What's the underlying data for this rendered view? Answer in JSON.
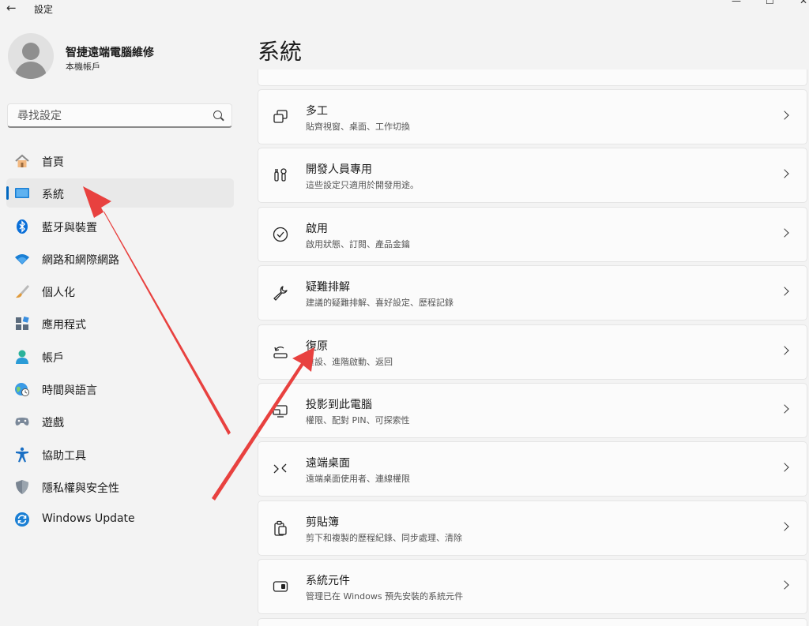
{
  "window": {
    "back_glyph": "←",
    "title": "設定",
    "minimize": "—",
    "maximize": "☐",
    "close": "✕"
  },
  "account": {
    "name": "智捷遠端電腦維修",
    "type": "本機帳戶"
  },
  "search": {
    "placeholder": "尋找設定"
  },
  "sidebar": {
    "items": [
      {
        "label": "首頁",
        "icon": "home-icon"
      },
      {
        "label": "系統",
        "icon": "system-icon",
        "selected": true
      },
      {
        "label": "藍牙與裝置",
        "icon": "bluetooth-icon"
      },
      {
        "label": "網路和網際網路",
        "icon": "wifi-icon"
      },
      {
        "label": "個人化",
        "icon": "brush-icon"
      },
      {
        "label": "應用程式",
        "icon": "apps-icon"
      },
      {
        "label": "帳戶",
        "icon": "account-icon"
      },
      {
        "label": "時間與語言",
        "icon": "globe-clock-icon"
      },
      {
        "label": "遊戲",
        "icon": "gamepad-icon"
      },
      {
        "label": "協助工具",
        "icon": "accessibility-icon"
      },
      {
        "label": "隱私權與安全性",
        "icon": "shield-icon"
      },
      {
        "label": "Windows Update",
        "icon": "update-icon"
      }
    ]
  },
  "main": {
    "title": "系統",
    "cards": [
      {
        "title": "多工",
        "desc": "貼齊視窗、桌面、工作切換",
        "icon": "multitasking-icon"
      },
      {
        "title": "開發人員專用",
        "desc": "這些設定只適用於開發用途。",
        "icon": "developer-icon"
      },
      {
        "title": "啟用",
        "desc": "啟用狀態、訂閱、產品金鑰",
        "icon": "activation-icon"
      },
      {
        "title": "疑難排解",
        "desc": "建議的疑難排解、喜好設定、歷程記錄",
        "icon": "wrench-icon"
      },
      {
        "title": "復原",
        "desc": "重設、進階啟動、返回",
        "icon": "recovery-icon"
      },
      {
        "title": "投影到此電腦",
        "desc": "權限、配對 PIN、可探索性",
        "icon": "projection-icon"
      },
      {
        "title": "遠端桌面",
        "desc": "遠端桌面使用者、連線權限",
        "icon": "remote-desktop-icon"
      },
      {
        "title": "剪貼簿",
        "desc": "剪下和複製的歷程紀錄、同步處理、清除",
        "icon": "clipboard-icon"
      },
      {
        "title": "系統元件",
        "desc": "管理已在 Windows 預先安裝的系統元件",
        "icon": "components-icon"
      }
    ]
  },
  "colors": {
    "accent": "#0067c0",
    "annotation_arrow": "#e8413f"
  }
}
